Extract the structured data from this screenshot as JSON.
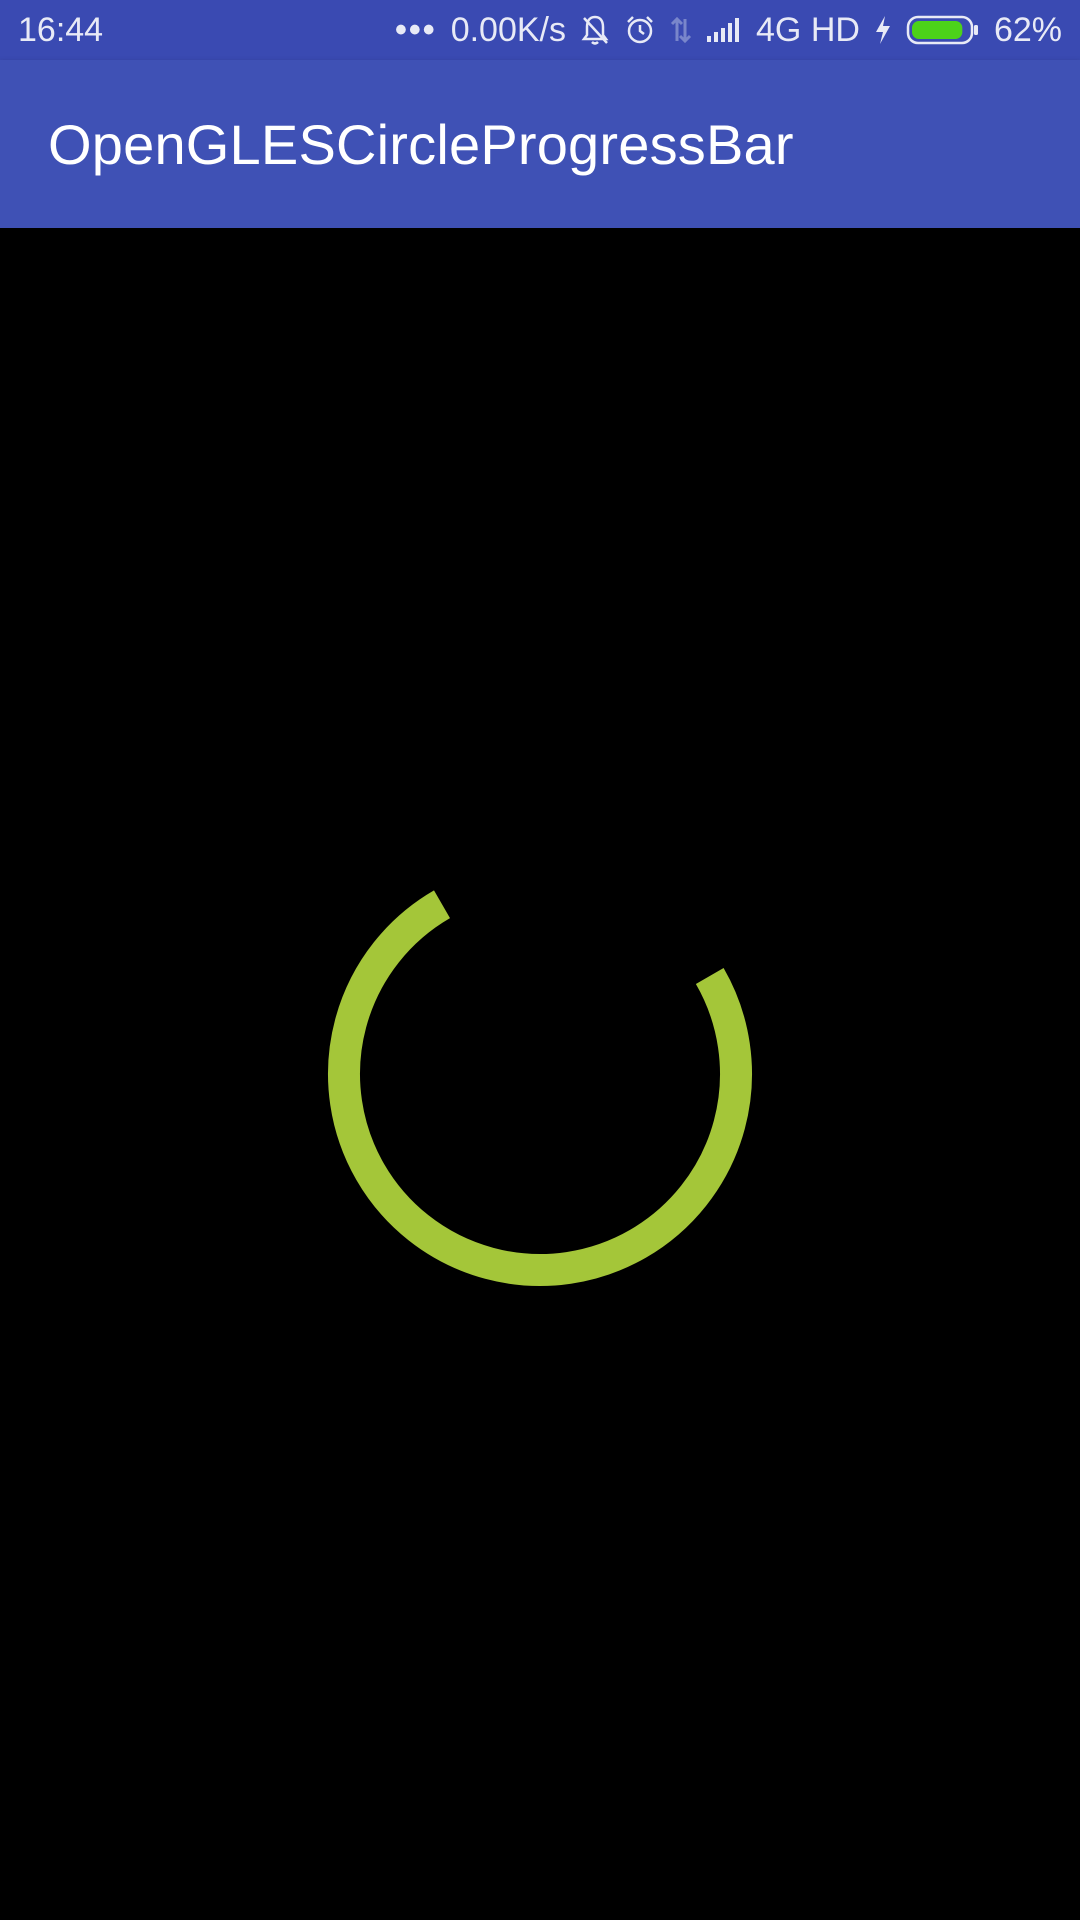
{
  "status_bar": {
    "time": "16:44",
    "more_indicator": "•••",
    "net_speed": "0.00K/s",
    "network_type": "4G HD",
    "battery_percent": "62%",
    "battery_level": 0.62,
    "icons": [
      "notifications-off-icon",
      "alarm-icon",
      "data-transfer-icon",
      "signal-icon",
      "charging-bolt-icon",
      "battery-icon"
    ]
  },
  "app_bar": {
    "title": "OpenGLESCircleProgressBar"
  },
  "colors": {
    "status_bar": "#3a4ab2",
    "app_bar": "#3f51b5",
    "background": "#000000",
    "progress_arc": "#a4c639",
    "battery_fill": "#4cd21a"
  },
  "progress": {
    "arc_start_deg": 330,
    "arc_end_deg": 420
  }
}
